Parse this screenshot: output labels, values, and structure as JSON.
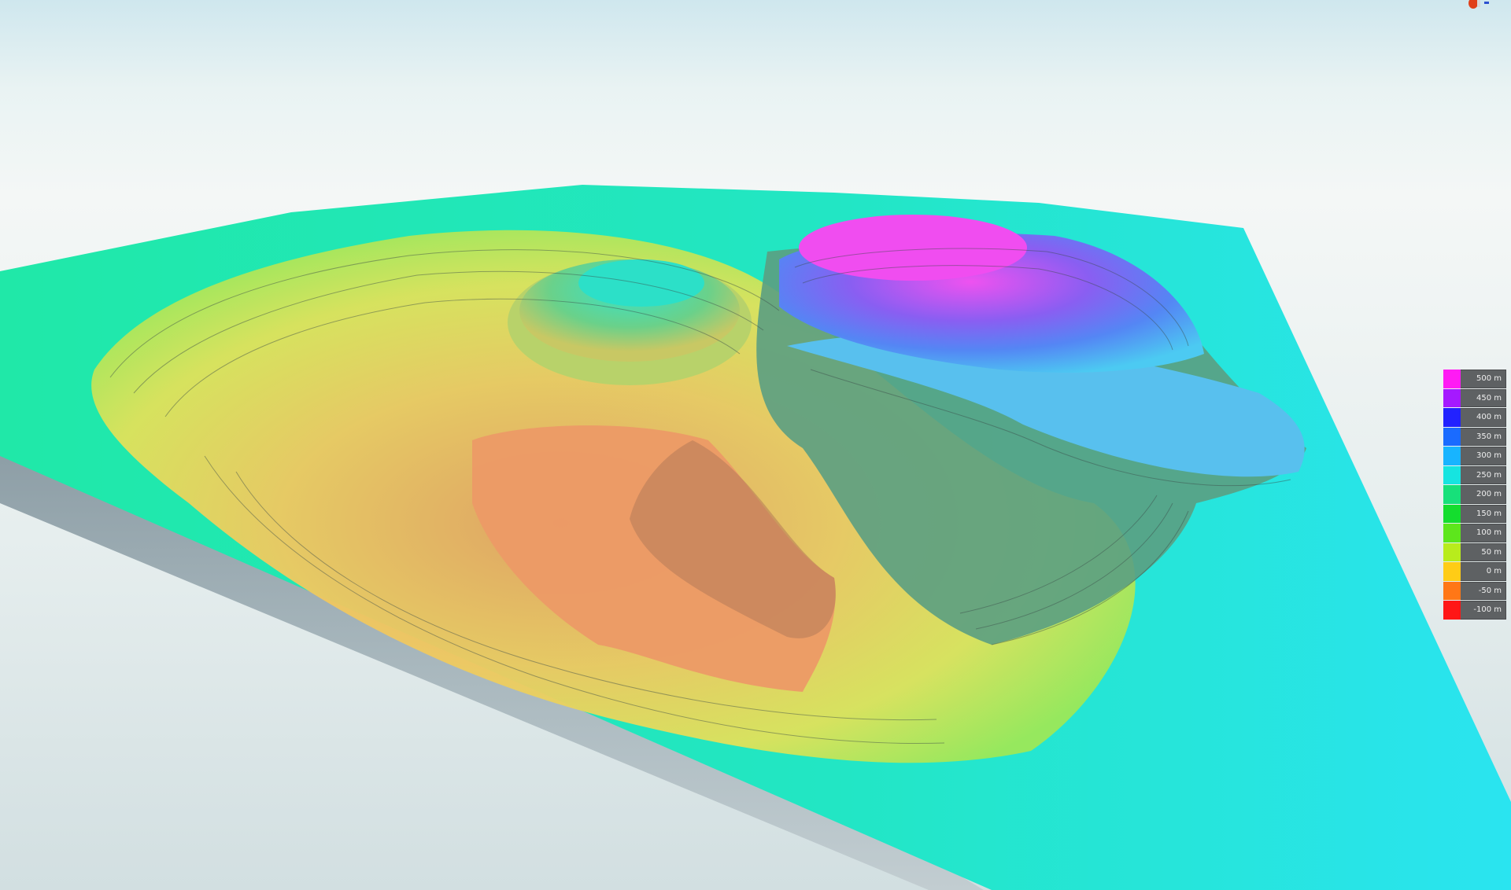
{
  "scene": {
    "description_colors": {
      "sky_top": "#cfe7ee",
      "ground": "#d2dfe1"
    }
  },
  "legend": {
    "items": [
      {
        "label": "500 m",
        "color": "#ff1bf4"
      },
      {
        "label": "450 m",
        "color": "#a519ff"
      },
      {
        "label": "400 m",
        "color": "#2222ff"
      },
      {
        "label": "350 m",
        "color": "#1a6bff"
      },
      {
        "label": "300 m",
        "color": "#18b4ff"
      },
      {
        "label": "250 m",
        "color": "#16e4e0"
      },
      {
        "label": "200 m",
        "color": "#17e07a"
      },
      {
        "label": "150 m",
        "color": "#14dd2e"
      },
      {
        "label": "100 m",
        "color": "#5de61c"
      },
      {
        "label": "50 m",
        "color": "#b8ec1c"
      },
      {
        "label": "0 m",
        "color": "#ffcc16"
      },
      {
        "label": "-50 m",
        "color": "#ff7716"
      },
      {
        "label": "-100 m",
        "color": "#ff1616"
      }
    ]
  },
  "gizmo": {
    "icon": "axis-gizmo-icon",
    "colors": [
      "#e0401a",
      "#c0c0c0",
      "#2a50d0"
    ]
  }
}
